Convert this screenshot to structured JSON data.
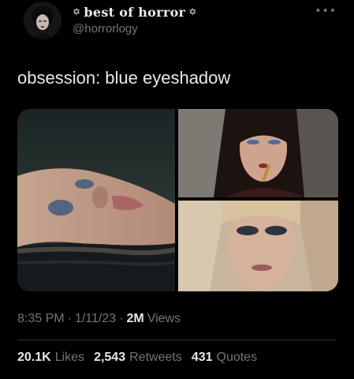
{
  "author": {
    "display_name": "best of horror",
    "name_prefix_symbol": "✡",
    "name_suffix_symbol": "✡",
    "handle": "@horrorlogy",
    "avatar_icon": "profile-avatar"
  },
  "more_icon": "more-options-icon",
  "tweet": {
    "text": "obsession: blue eyeshadow"
  },
  "media": [
    {
      "description_icon": "photo-woman-lying-in-water"
    },
    {
      "description_icon": "photo-woman-dark-hair-lipstick"
    },
    {
      "description_icon": "photo-blonde-woman-eyes-closed"
    }
  ],
  "meta": {
    "time": "8:35 PM",
    "separator": "·",
    "date": "1/11/23",
    "separator2": "·",
    "views_count": "2M",
    "views_label": "Views"
  },
  "stats": {
    "likes_count": "20.1K",
    "likes_label": "Likes",
    "retweets_count": "2,543",
    "retweets_label": "Retweets",
    "quotes_count": "431",
    "quotes_label": "Quotes"
  },
  "colors": {
    "background": "#000000",
    "primary_text": "#e7e9ea",
    "secondary_text": "#71767b",
    "divider": "#2f3336"
  }
}
